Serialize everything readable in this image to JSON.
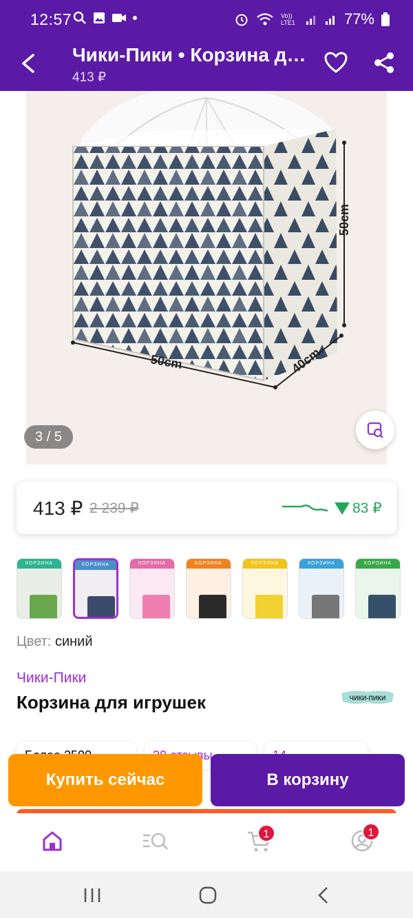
{
  "status_bar": {
    "time": "12:57",
    "battery": "77%",
    "network_label": "Vo)) LTE1"
  },
  "header": {
    "title": "Чики-Пики • Корзина для игрушек",
    "subtitle": "413 ₽",
    "back_icon": "back-arrow-icon",
    "heart_icon": "heart-outline-icon",
    "share_icon": "share-icon"
  },
  "gallery": {
    "counter": "3 / 5",
    "dimensions": {
      "height": "50cm",
      "width": "50cm",
      "depth": "40cm"
    }
  },
  "price": {
    "current": "413 ₽",
    "old": "2 239 ₽",
    "drop": "83 ₽",
    "drop_color": "#23a85b"
  },
  "thumbnails": [
    {
      "band_text": "КОРЗИНА",
      "band_color": "#2db38f",
      "body_color": "#e9efe6",
      "basket_color": "#6aa84f",
      "selected": false
    },
    {
      "band_text": "КОРЗИНА",
      "band_color": "#4a90c8",
      "body_color": "#f0eef0",
      "basket_color": "#3b4a6a",
      "selected": true
    },
    {
      "band_text": "КОРЗИНА",
      "band_color": "#e56ba8",
      "body_color": "#fbeaf3",
      "basket_color": "#ef7fb0",
      "selected": false
    },
    {
      "band_text": "КОРЗИНА",
      "band_color": "#f0821e",
      "body_color": "#fdf0e3",
      "basket_color": "#2a2a2a",
      "selected": false
    },
    {
      "band_text": "КОРЗИНА",
      "band_color": "#f2c418",
      "body_color": "#fdf7e0",
      "basket_color": "#f2d232",
      "selected": false
    },
    {
      "band_text": "КОРЗИНА",
      "band_color": "#3aa0d8",
      "body_color": "#e8f2f8",
      "basket_color": "#777777",
      "selected": false
    },
    {
      "band_text": "КОРЗИНА",
      "band_color": "#38a84a",
      "body_color": "#eaf6ec",
      "basket_color": "#35506a",
      "selected": false
    }
  ],
  "product": {
    "color_label": "Цвет:",
    "color_value": "синий",
    "brand": "Чики-Пики",
    "name": "Корзина для игрушек",
    "brand_logo_text": "ЧИКИ-ПИКИ"
  },
  "chips": [
    "Более 2500",
    "20 отзывы",
    "14 ..."
  ],
  "actions": {
    "buy_now": "Купить сейчас",
    "add_to_cart": "В корзину"
  },
  "bottom_nav": {
    "items": [
      {
        "name": "home-icon",
        "active": true
      },
      {
        "name": "catalog-icon",
        "active": false
      },
      {
        "name": "cart-icon",
        "badge": "1"
      },
      {
        "name": "profile-icon",
        "badge": "1"
      }
    ],
    "accent": "#9b30d0"
  }
}
